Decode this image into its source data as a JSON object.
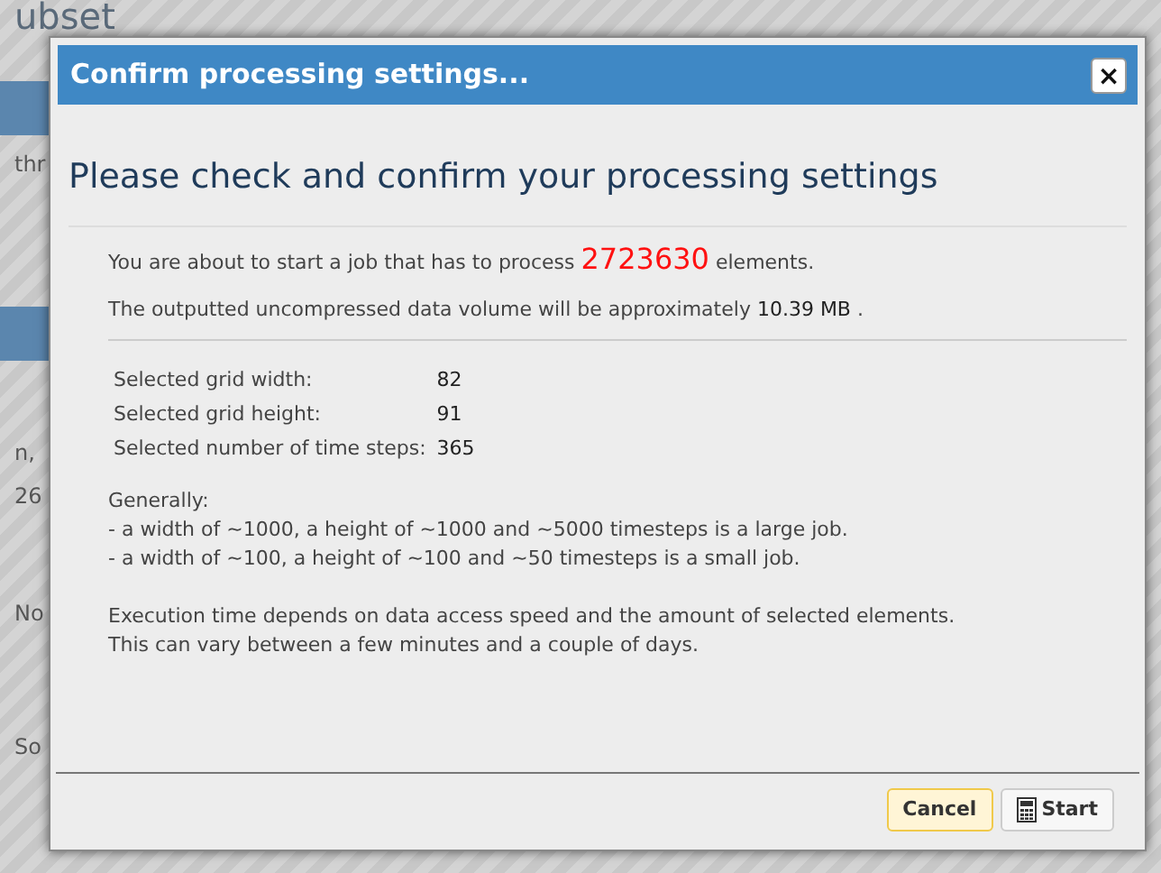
{
  "background": {
    "heading": "ubset",
    "fragments": [
      "thr",
      "n,",
      "26",
      "No",
      "So"
    ]
  },
  "dialog": {
    "title": "Confirm processing settings...",
    "close": "×",
    "heading": "Please check and confirm your processing settings",
    "job_line": {
      "before": "You are about to start a job that has to process",
      "count": "2723630",
      "after": "elements."
    },
    "volume_line": {
      "before": "The outputted uncompressed data volume will be approximately",
      "value": "10.39",
      "unit": "MB",
      "after": "."
    },
    "settings": [
      {
        "label": "Selected grid width:",
        "value": "82"
      },
      {
        "label": "Selected grid height:",
        "value": "91"
      },
      {
        "label": "Selected number of time steps:",
        "value": "365"
      }
    ],
    "notes": [
      "Generally:",
      "- a width of ~1000, a height of ~1000 and ~5000 timesteps is a large job.",
      "- a width of ~100, a height of ~100 and ~50 timesteps is a small job."
    ],
    "execution": [
      "Execution time depends on data access speed and the amount of selected elements.",
      "This can vary between a few minutes and a couple of days."
    ],
    "buttons": [
      {
        "kind": "cancel",
        "label": "Cancel"
      },
      {
        "kind": "start",
        "label": "Start"
      }
    ]
  }
}
